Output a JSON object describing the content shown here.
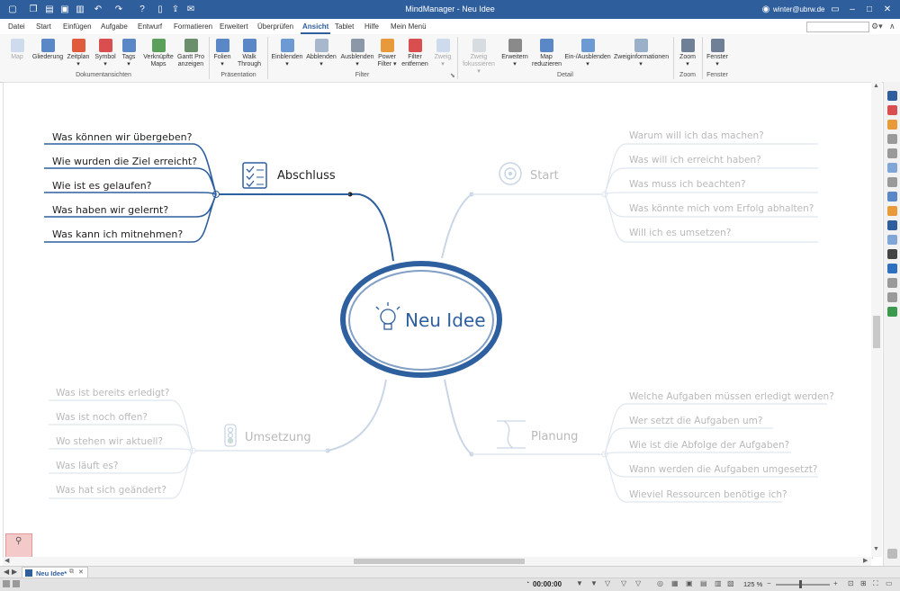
{
  "titlebar": {
    "title": "MindManager - Neu Idee",
    "user": "winter@ubrw.de",
    "qat_icons": [
      "new-icon",
      "copy-icon",
      "open-icon",
      "save-icon",
      "print-icon",
      "undo-icon",
      "redo-icon",
      "help-icon",
      "document-icon",
      "export-icon",
      "mail-icon"
    ]
  },
  "tabs": [
    "Datei",
    "Start",
    "Einfügen",
    "Aufgabe",
    "Entwurf",
    "Formatieren",
    "Erweitert",
    "Überprüfen",
    "Ansicht",
    "Tablet",
    "Hilfe",
    "Mein Menü"
  ],
  "active_tab": "Ansicht",
  "ribbon": {
    "groups": {
      "doc_views": "Dokumentansichten",
      "presentation": "Präsentation",
      "filter": "Filter",
      "detail": "Detail",
      "zoom": "Zoom",
      "window": "Fenster"
    },
    "buttons": {
      "map": "Map",
      "outline": "Gliederung",
      "timeline": "Zeitplan",
      "symbol": "Symbol",
      "tags": "Tags",
      "linked1": "Verknüpfte",
      "linked2": "Maps",
      "gantt1": "Gantt Pro",
      "gantt2": "anzeigen",
      "slides": "Folien",
      "walk1": "Walk",
      "walk2": "Through",
      "show": "Einblenden",
      "dim": "Abblenden",
      "hide": "Ausblenden",
      "power1": "Power",
      "power2": "Filter",
      "rmfilter1": "Filter",
      "rmfilter2": "entfernen",
      "branch": "Zweig",
      "focus1": "Zweig",
      "focus2": "fokussieren",
      "expand": "Erweitern",
      "reduce1": "Map",
      "reduce2": "reduzieren",
      "toggle": "Ein-/Ausblenden",
      "branchinfo": "Zweiginformationen",
      "zoom": "Zoom",
      "window": "Fenster"
    }
  },
  "map": {
    "central": "Neu Idee",
    "branches": {
      "abschluss": {
        "label": "Abschluss",
        "items": [
          "Was können wir übergeben?",
          "Wie wurden die Ziel erreicht?",
          "Wie ist es gelaufen?",
          "Was haben wir gelernt?",
          "Was kann ich mitnehmen?"
        ]
      },
      "start": {
        "label": "Start",
        "items": [
          "Warum will ich das machen?",
          "Was will ich erreicht haben?",
          "Was muss ich beachten?",
          "Was könnte mich vom Erfolg abhalten?",
          "Will ich es umsetzen?"
        ]
      },
      "umsetzung": {
        "label": "Umsetzung",
        "items": [
          "Was ist bereits erledigt?",
          "Was ist noch offen?",
          "Wo stehen wir aktuell?",
          "Was läuft es?",
          "Was hat sich geändert?"
        ]
      },
      "planung": {
        "label": "Planung",
        "items": [
          "Welche Aufgaben müssen erledigt werden?",
          "Wer setzt die Aufgaben um?",
          "Wie ist die Abfolge der Aufgaben?",
          "Wann werden die Aufgaben umgesetzt?",
          "Wieviel Ressourcen benötige ich?"
        ]
      }
    }
  },
  "doctab": {
    "label": "Neu Idee*"
  },
  "status": {
    "timer": "00:00:00",
    "zoom": "125 %"
  },
  "colors": {
    "brand": "#2f5e9c",
    "active_branch": "#2e5f9e",
    "dimmed": "#c9d6e6",
    "dimmed_text": "#b9b9b9"
  }
}
